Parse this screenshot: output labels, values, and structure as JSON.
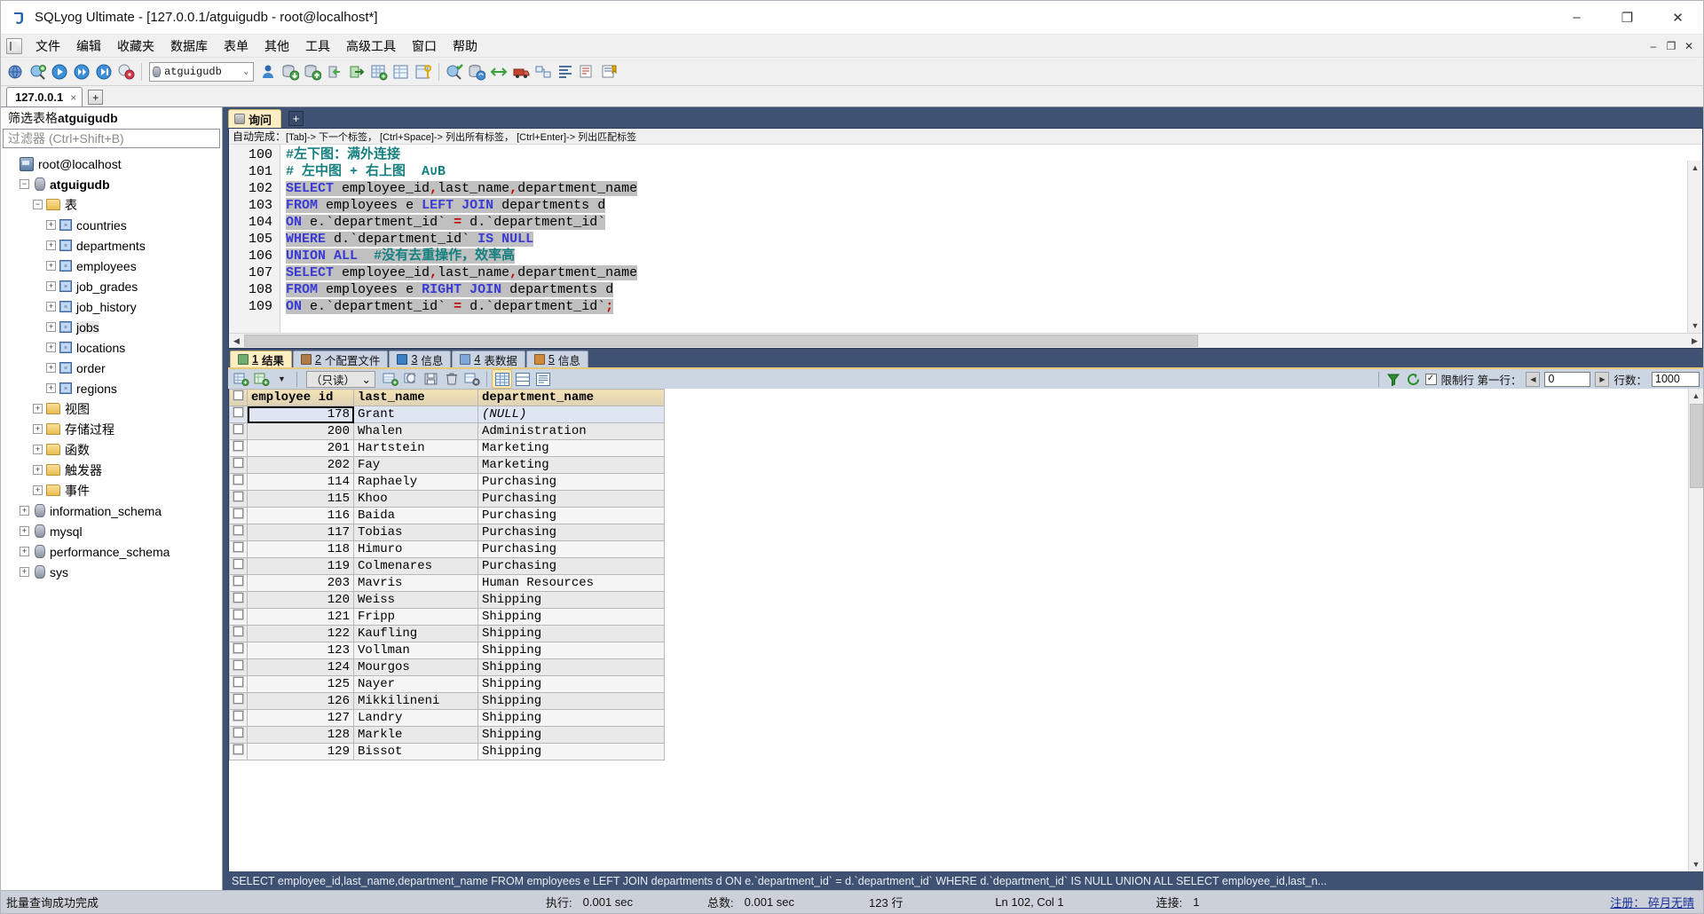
{
  "window": {
    "title": "SQLyog Ultimate - [127.0.0.1/atguigudb - root@localhost*]",
    "app_icon": "sqlyog-icon",
    "minimize": "–",
    "maximize": "❐",
    "close": "✕"
  },
  "menu": {
    "items": [
      {
        "label": "文件"
      },
      {
        "label": "编辑"
      },
      {
        "label": "收藏夹"
      },
      {
        "label": "数据库"
      },
      {
        "label": "表单"
      },
      {
        "label": "其他"
      },
      {
        "label": "工具"
      },
      {
        "label": "高级工具"
      },
      {
        "label": "窗口"
      },
      {
        "label": "帮助"
      }
    ],
    "mdi_minimize": "–",
    "mdi_restore": "❐",
    "mdi_close": "✕"
  },
  "toolbar": {
    "db_selector_value": "atguigudb",
    "db_selector_arrow": "⌄",
    "buttons": [
      "new-connection-icon",
      "new-query-icon",
      "execute-query-icon",
      "execute-all-icon",
      "execute-current-icon",
      "refresh-objects-icon",
      "user-manager-icon",
      "backup-database-icon",
      "restore-database-icon",
      "import-data-icon",
      "export-data-icon",
      "table-data-icon",
      "schema-designer-icon",
      "grant-icon",
      "sync-icon",
      "migrate-icon",
      "tunnel-icon",
      "scheduler-icon",
      "query-builder-icon",
      "sql-formatter-icon",
      "find-icon",
      "bookmark-icon"
    ]
  },
  "connection_tabs": {
    "tabs": [
      {
        "label": "127.0.0.1",
        "close": "×"
      }
    ],
    "add_label": "+"
  },
  "sidebar": {
    "filter_title_prefix": "筛选表格 ",
    "filter_title_db": "atguigudb",
    "filter_placeholder": "过滤器 (Ctrl+Shift+B)",
    "nodes": [
      {
        "label": "root@localhost",
        "icon": "server-icon",
        "indent": 0,
        "expander": "",
        "bold": false,
        "selected": false
      },
      {
        "label": "atguigudb",
        "icon": "database-icon",
        "indent": 1,
        "expander": "−",
        "bold": true,
        "selected": false
      },
      {
        "label": "表",
        "icon": "folder-icon",
        "indent": 2,
        "expander": "−",
        "bold": false,
        "selected": false
      },
      {
        "label": "countries",
        "icon": "table-icon",
        "indent": 3,
        "expander": "+",
        "bold": false,
        "selected": false
      },
      {
        "label": "departments",
        "icon": "table-icon",
        "indent": 3,
        "expander": "+",
        "bold": false,
        "selected": false
      },
      {
        "label": "employees",
        "icon": "table-icon",
        "indent": 3,
        "expander": "+",
        "bold": false,
        "selected": false
      },
      {
        "label": "job_grades",
        "icon": "table-icon",
        "indent": 3,
        "expander": "+",
        "bold": false,
        "selected": false
      },
      {
        "label": "job_history",
        "icon": "table-icon",
        "indent": 3,
        "expander": "+",
        "bold": false,
        "selected": false
      },
      {
        "label": "jobs",
        "icon": "table-icon",
        "indent": 3,
        "expander": "+",
        "bold": false,
        "selected": true
      },
      {
        "label": "locations",
        "icon": "table-icon",
        "indent": 3,
        "expander": "+",
        "bold": false,
        "selected": false
      },
      {
        "label": "order",
        "icon": "table-icon",
        "indent": 3,
        "expander": "+",
        "bold": false,
        "selected": false
      },
      {
        "label": "regions",
        "icon": "table-icon",
        "indent": 3,
        "expander": "+",
        "bold": false,
        "selected": false
      },
      {
        "label": "视图",
        "icon": "folder-icon",
        "indent": 2,
        "expander": "+",
        "bold": false,
        "selected": false
      },
      {
        "label": "存储过程",
        "icon": "folder-icon",
        "indent": 2,
        "expander": "+",
        "bold": false,
        "selected": false
      },
      {
        "label": "函数",
        "icon": "folder-icon",
        "indent": 2,
        "expander": "+",
        "bold": false,
        "selected": false
      },
      {
        "label": "触发器",
        "icon": "folder-icon",
        "indent": 2,
        "expander": "+",
        "bold": false,
        "selected": false
      },
      {
        "label": "事件",
        "icon": "folder-icon",
        "indent": 2,
        "expander": "+",
        "bold": false,
        "selected": false
      },
      {
        "label": "information_schema",
        "icon": "database-icon",
        "indent": 1,
        "expander": "+",
        "bold": false,
        "selected": false
      },
      {
        "label": "mysql",
        "icon": "database-icon",
        "indent": 1,
        "expander": "+",
        "bold": false,
        "selected": false
      },
      {
        "label": "performance_schema",
        "icon": "database-icon",
        "indent": 1,
        "expander": "+",
        "bold": false,
        "selected": false
      },
      {
        "label": "sys",
        "icon": "database-icon",
        "indent": 1,
        "expander": "+",
        "bold": false,
        "selected": false
      }
    ]
  },
  "query_tabs": {
    "tabs": [
      {
        "label": "询问",
        "icon": "query-tab-icon"
      }
    ],
    "add_label": "+"
  },
  "editor": {
    "hint_prefix": "自动完成：",
    "hint_rest": "[Tab]-> 下一个标签， [Ctrl+Space]-> 列出所有标签， [Ctrl+Enter]-> 列出匹配标签",
    "first_line_number": 100,
    "lines": [
      {
        "n": "100",
        "text": "#左下图：满外连接",
        "selected": false
      },
      {
        "n": "101",
        "text": "# 左中图 + 右上图  A∪B",
        "selected": false
      },
      {
        "n": "102",
        "text": "SELECT employee_id,last_name,department_name",
        "selected": true
      },
      {
        "n": "103",
        "text": "FROM employees e LEFT JOIN departments d",
        "selected": true
      },
      {
        "n": "104",
        "text": "ON e.`department_id` = d.`department_id`",
        "selected": true
      },
      {
        "n": "105",
        "text": "WHERE d.`department_id` IS NULL",
        "selected": true
      },
      {
        "n": "106",
        "text": "UNION ALL  #没有去重操作，效率高",
        "selected": true
      },
      {
        "n": "107",
        "text": "SELECT employee_id,last_name,department_name",
        "selected": true
      },
      {
        "n": "108",
        "text": "FROM employees e RIGHT JOIN departments d",
        "selected": true
      },
      {
        "n": "109",
        "text": "ON e.`department_id` = d.`department_id`;",
        "selected": true
      }
    ]
  },
  "result_tabs": {
    "tabs": [
      {
        "num": "1",
        "label": "结果",
        "icon": "result-grid-icon",
        "active": true
      },
      {
        "num": "2",
        "label": "个配置文件",
        "icon": "profile-icon",
        "active": false
      },
      {
        "num": "3",
        "label": "信息",
        "icon": "info-icon",
        "active": false
      },
      {
        "num": "4",
        "label": "表数据",
        "icon": "table-data-icon",
        "active": false
      },
      {
        "num": "5",
        "label": "信息",
        "icon": "messages-icon",
        "active": false
      }
    ]
  },
  "result_toolbar": {
    "readonly_value": "（只读）",
    "readonly_arrow": "⌄",
    "limit_checkbox_checked": "✓",
    "limit_label": "限制行 第一行：",
    "offset_value": "0",
    "rows_label": "行数：",
    "rows_value": "1000",
    "prev_arrow": "◀",
    "next_arrow": "▶",
    "buttons": [
      "grid-view-icon",
      "form-view-icon",
      "text-view-icon",
      "insert-row-icon",
      "refresh-row-icon",
      "save-row-icon",
      "delete-row-icon",
      "cancel-row-icon",
      "filter-icon",
      "refresh-icon"
    ]
  },
  "grid": {
    "columns": [
      "employee id",
      "last_name",
      "department_name"
    ],
    "rows": [
      {
        "employee_id": "178",
        "last_name": "Grant",
        "department_name": "(NULL)",
        "is_null": true,
        "selected": true
      },
      {
        "employee_id": "200",
        "last_name": "Whalen",
        "department_name": "Administration",
        "is_null": false,
        "selected": false
      },
      {
        "employee_id": "201",
        "last_name": "Hartstein",
        "department_name": "Marketing",
        "is_null": false,
        "selected": false
      },
      {
        "employee_id": "202",
        "last_name": "Fay",
        "department_name": "Marketing",
        "is_null": false,
        "selected": false
      },
      {
        "employee_id": "114",
        "last_name": "Raphaely",
        "department_name": "Purchasing",
        "is_null": false,
        "selected": false
      },
      {
        "employee_id": "115",
        "last_name": "Khoo",
        "department_name": "Purchasing",
        "is_null": false,
        "selected": false
      },
      {
        "employee_id": "116",
        "last_name": "Baida",
        "department_name": "Purchasing",
        "is_null": false,
        "selected": false
      },
      {
        "employee_id": "117",
        "last_name": "Tobias",
        "department_name": "Purchasing",
        "is_null": false,
        "selected": false
      },
      {
        "employee_id": "118",
        "last_name": "Himuro",
        "department_name": "Purchasing",
        "is_null": false,
        "selected": false
      },
      {
        "employee_id": "119",
        "last_name": "Colmenares",
        "department_name": "Purchasing",
        "is_null": false,
        "selected": false
      },
      {
        "employee_id": "203",
        "last_name": "Mavris",
        "department_name": "Human Resources",
        "is_null": false,
        "selected": false
      },
      {
        "employee_id": "120",
        "last_name": "Weiss",
        "department_name": "Shipping",
        "is_null": false,
        "selected": false
      },
      {
        "employee_id": "121",
        "last_name": "Fripp",
        "department_name": "Shipping",
        "is_null": false,
        "selected": false
      },
      {
        "employee_id": "122",
        "last_name": "Kaufling",
        "department_name": "Shipping",
        "is_null": false,
        "selected": false
      },
      {
        "employee_id": "123",
        "last_name": "Vollman",
        "department_name": "Shipping",
        "is_null": false,
        "selected": false
      },
      {
        "employee_id": "124",
        "last_name": "Mourgos",
        "department_name": "Shipping",
        "is_null": false,
        "selected": false
      },
      {
        "employee_id": "125",
        "last_name": "Nayer",
        "department_name": "Shipping",
        "is_null": false,
        "selected": false
      },
      {
        "employee_id": "126",
        "last_name": "Mikkilineni",
        "department_name": "Shipping",
        "is_null": false,
        "selected": false
      },
      {
        "employee_id": "127",
        "last_name": "Landry",
        "department_name": "Shipping",
        "is_null": false,
        "selected": false
      },
      {
        "employee_id": "128",
        "last_name": "Markle",
        "department_name": "Shipping",
        "is_null": false,
        "selected": false
      },
      {
        "employee_id": "129",
        "last_name": "Bissot",
        "department_name": "Shipping",
        "is_null": false,
        "selected": false
      }
    ]
  },
  "sql_preview": {
    "text": "SELECT employee_id,last_name,department_name FROM employees e LEFT JOIN departments d ON e.`department_id` = d.`department_id` WHERE d.`department_id` IS NULL UNION ALL SELECT employee_id,last_n..."
  },
  "statusbar": {
    "message": "批量查询成功完成",
    "exec_label": "执行:",
    "exec_value": "0.001 sec",
    "total_label": "总数:",
    "total_value": "0.001 sec",
    "rows": "123 行",
    "cursor": "Ln 102, Col 1",
    "conn_label": "连接:",
    "conn_value": "1",
    "register": "注册： 碎月无晴"
  },
  "colors": {
    "accent_blue": "#3f5274",
    "tab_active": "#ffeec4",
    "keyword": "#3a3ad4",
    "comment": "#168080",
    "operator": "#c00000"
  }
}
